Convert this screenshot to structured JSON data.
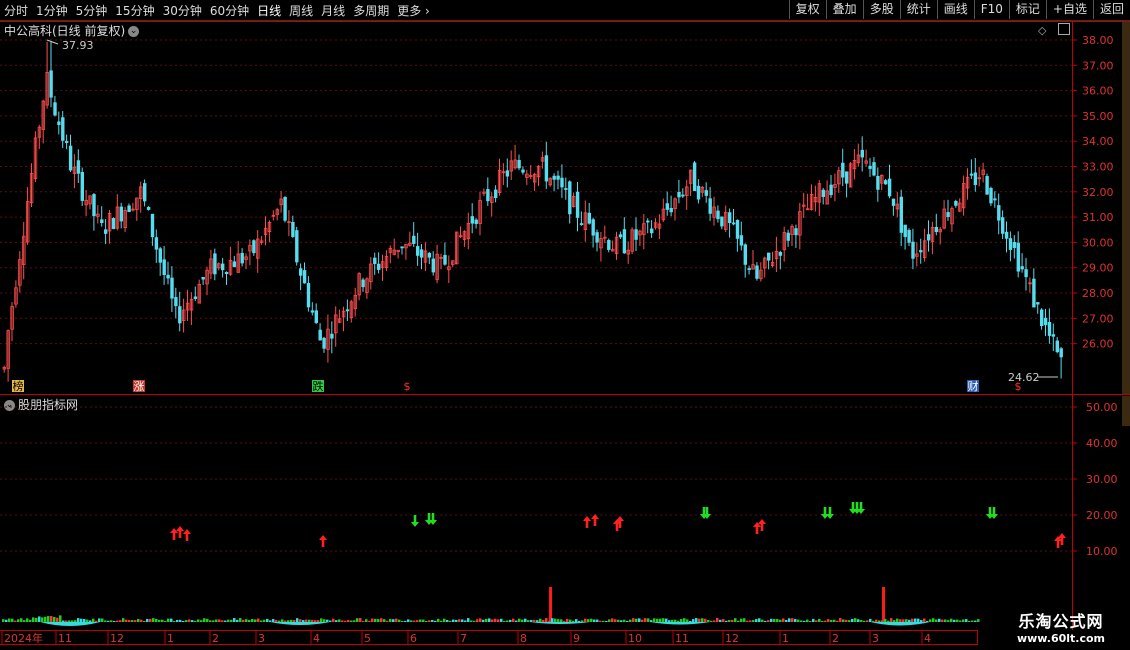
{
  "toolbar": {
    "periods": [
      "分时",
      "1分钟",
      "5分钟",
      "15分钟",
      "30分钟",
      "60分钟",
      "日线",
      "周线",
      "月线",
      "多周期"
    ],
    "active_period": "日线",
    "more_label": "更多",
    "more_icon": "chevron-right-icon",
    "buttons": [
      "复权",
      "叠加",
      "多股",
      "统计",
      "画线",
      "F10",
      "标记",
      "+自选",
      "返回"
    ]
  },
  "chart": {
    "title": "中公高科(日线 前复权)",
    "toggle_icon": "chevron-down-icon",
    "high_label": "37.93",
    "low_label": "24.62",
    "price_ticks": [
      "38.00",
      "37.00",
      "36.00",
      "35.00",
      "34.00",
      "33.00",
      "32.00",
      "31.00",
      "30.00",
      "29.00",
      "28.00",
      "27.00",
      "26.00"
    ],
    "event_markers": [
      {
        "label": "榜",
        "color": "#e8b84a",
        "text_color": "#000"
      },
      {
        "label": "涨",
        "color": "#c0392b",
        "text_color": "#fff"
      },
      {
        "label": "跌",
        "color": "#2ecc40",
        "text_color": "#000"
      },
      {
        "label": "$",
        "color": "#000",
        "text_color": "#ff3333"
      },
      {
        "label": "财",
        "color": "#2a5db0",
        "text_color": "#fff"
      },
      {
        "label": "$",
        "color": "#000",
        "text_color": "#ff3333"
      }
    ],
    "colors": {
      "up": "#ff4d4d",
      "down": "#55ddee",
      "grid": "#5a1010",
      "axis": "#c00000"
    }
  },
  "indicator": {
    "title": "股朋指标网",
    "ticks": [
      "50.00",
      "40.00",
      "30.00",
      "20.00",
      "10.00"
    ],
    "signals": {
      "up_color": "#ff2020",
      "down_color": "#22dd22"
    }
  },
  "time_axis": {
    "labels": [
      "2024年",
      "11",
      "12",
      "1",
      "2",
      "3",
      "4",
      "5",
      "6",
      "7",
      "8",
      "9",
      "10",
      "11",
      "12",
      "1",
      "2",
      "3",
      "4"
    ]
  },
  "watermark": {
    "line1": "乐淘公式网",
    "line2": "www.60lt.com"
  }
}
